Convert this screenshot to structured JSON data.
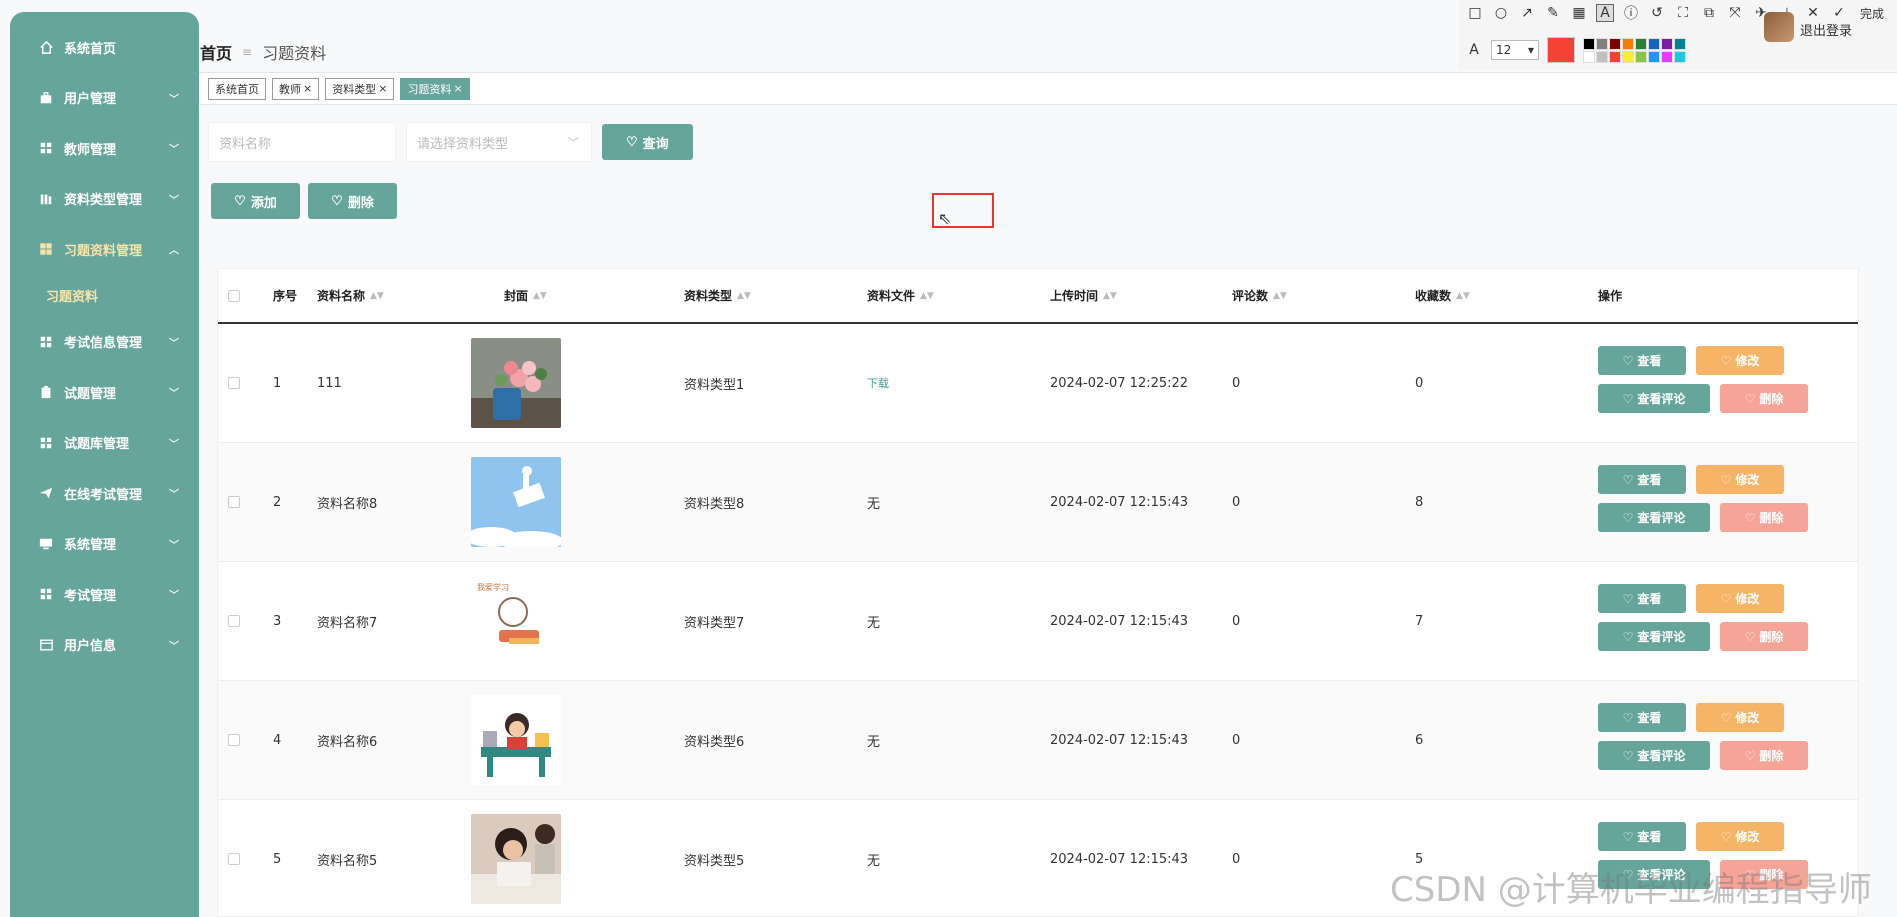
{
  "sidebar": {
    "items": [
      {
        "label": "系统首页",
        "icon": "home-icon",
        "chevron": false
      },
      {
        "label": "用户管理",
        "icon": "briefcase-icon",
        "chevron": true
      },
      {
        "label": "教师管理",
        "icon": "grid-icon",
        "chevron": true
      },
      {
        "label": "资料类型管理",
        "icon": "bars-icon",
        "chevron": true
      },
      {
        "label": "习题资料管理",
        "icon": "grid-icon",
        "chevron": true,
        "active": true
      },
      {
        "label": "考试信息管理",
        "icon": "grid-icon",
        "chevron": true
      },
      {
        "label": "试题管理",
        "icon": "clipboard-icon",
        "chevron": true
      },
      {
        "label": "试题库管理",
        "icon": "grid-icon",
        "chevron": true
      },
      {
        "label": "在线考试管理",
        "icon": "send-icon",
        "chevron": true
      },
      {
        "label": "系统管理",
        "icon": "monitor-icon",
        "chevron": true
      },
      {
        "label": "考试管理",
        "icon": "grid-icon",
        "chevron": true
      },
      {
        "label": "用户信息",
        "icon": "card-icon",
        "chevron": true
      }
    ],
    "sub_item": "习题资料"
  },
  "breadcrumb": {
    "home": "首页",
    "separator": "≡",
    "current": "习题资料"
  },
  "tags": [
    {
      "label": "系统首页",
      "closable": false
    },
    {
      "label": "教师",
      "closable": true
    },
    {
      "label": "资料类型",
      "closable": true
    },
    {
      "label": "习题资料",
      "closable": true,
      "active": true
    }
  ],
  "search": {
    "name_placeholder": "资料名称",
    "type_placeholder": "请选择资料类型",
    "query_label": "查询"
  },
  "actions": {
    "add_label": "添加",
    "delete_label": "删除"
  },
  "table": {
    "headers": {
      "index": "序号",
      "name": "资料名称",
      "cover": "封面",
      "type": "资料类型",
      "file": "资料文件",
      "upload_time": "上传时间",
      "comments": "评论数",
      "favorites": "收藏数",
      "ops": "操作"
    },
    "rows": [
      {
        "index": "1",
        "name": "111",
        "cover": "flowers",
        "type": "资料类型1",
        "file": "下载",
        "time": "2024-02-07 12:25:22",
        "comments": "0",
        "favorites": "0"
      },
      {
        "index": "2",
        "name": "资料名称8",
        "cover": "sky",
        "type": "资料类型8",
        "file": "无",
        "time": "2024-02-07 12:15:43",
        "comments": "0",
        "favorites": "8"
      },
      {
        "index": "3",
        "name": "资料名称7",
        "cover": "cartoon",
        "type": "资料类型7",
        "file": "无",
        "time": "2024-02-07 12:15:43",
        "comments": "0",
        "favorites": "7"
      },
      {
        "index": "4",
        "name": "资料名称6",
        "cover": "desk",
        "type": "资料类型6",
        "file": "无",
        "time": "2024-02-07 12:15:43",
        "comments": "0",
        "favorites": "6"
      },
      {
        "index": "5",
        "name": "资料名称5",
        "cover": "girl",
        "type": "资料类型5",
        "file": "无",
        "time": "2024-02-07 12:15:43",
        "comments": "0",
        "favorites": "5"
      }
    ],
    "op_labels": {
      "view": "查看",
      "edit": "修改",
      "comments": "查看评论",
      "delete": "删除"
    }
  },
  "toolbar": {
    "font_size": "12",
    "done_label": "完成",
    "user_link": "退出登录"
  },
  "watermark": "CSDN @计算机毕业编程指导师",
  "colors": {
    "primary": "#66a59c",
    "edit": "#f6b566",
    "delete": "#f6a498",
    "active_text": "#f8e3a8"
  }
}
